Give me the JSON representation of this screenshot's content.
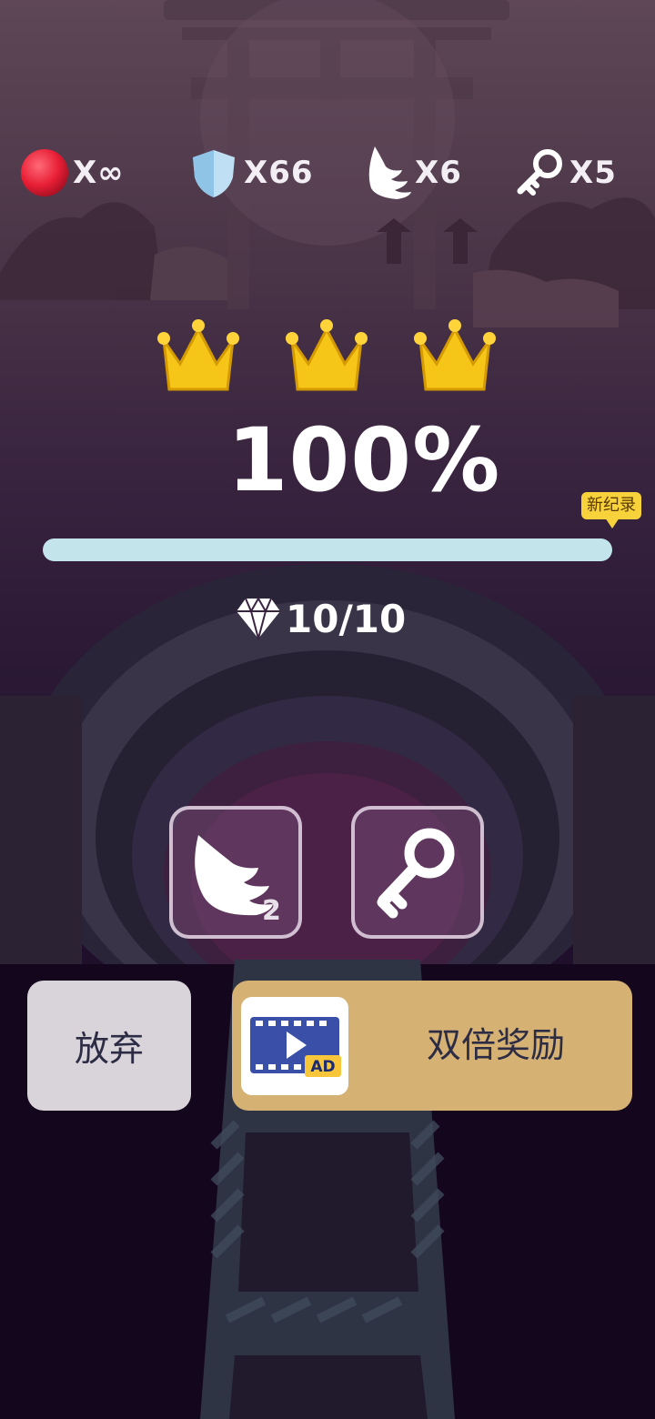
{
  "hud": {
    "lives": {
      "icon": "red-ball-icon",
      "count": "X∞"
    },
    "shields": {
      "icon": "shield-icon",
      "count": "X66"
    },
    "wings": {
      "icon": "wing-icon",
      "count": "X6"
    },
    "keys": {
      "icon": "key-icon",
      "count": "X5"
    }
  },
  "result": {
    "crowns_earned": 3,
    "crowns_total": 3,
    "percent": "100%",
    "progress_fraction": 1.0,
    "record_badge": "新纪录"
  },
  "gems": {
    "icon": "diamond-icon",
    "count": "10/10"
  },
  "powerups": [
    {
      "name": "wing",
      "icon": "wing-icon",
      "badge": "2"
    },
    {
      "name": "key",
      "icon": "key-icon"
    }
  ],
  "actions": {
    "quit_label": "放弃",
    "double_label": "双倍奖励",
    "ad_badge": "AD"
  },
  "colors": {
    "progress_fill": "#c3e4ea",
    "double_button": "#d5b174",
    "quit_button": "#d9d3da",
    "crown": "#f5c518"
  }
}
